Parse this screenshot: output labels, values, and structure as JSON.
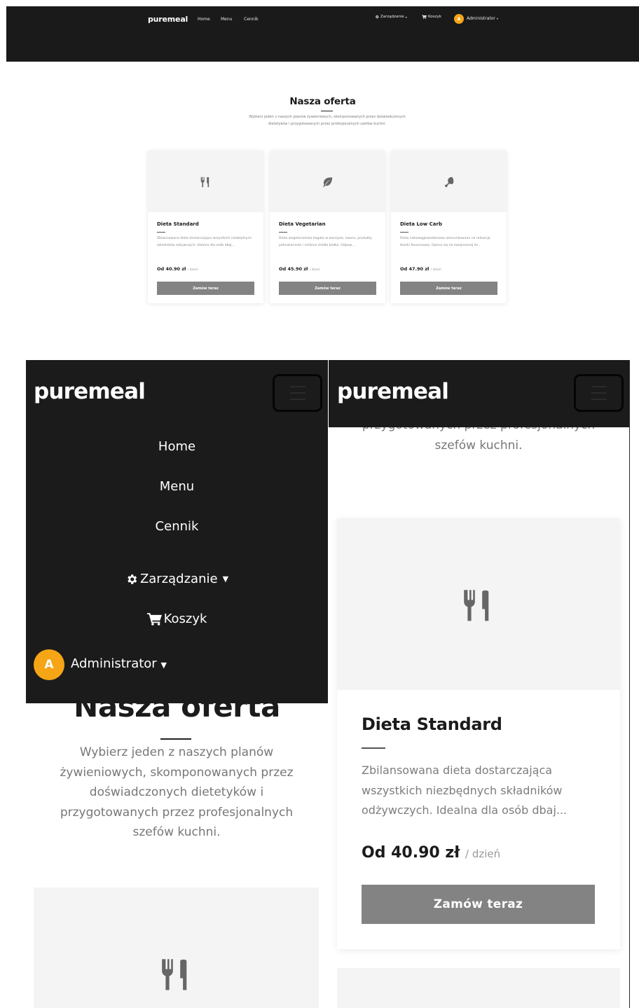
{
  "brand": "puremeal",
  "nav": {
    "links": [
      "Home",
      "Menu",
      "Cennik"
    ],
    "management": "Zarządzanie",
    "cart": "Koszyk",
    "avatar_initial": "A",
    "user": "Administrator"
  },
  "offer": {
    "title": "Nasza oferta",
    "subtitle": "Wybierz jeden z naszych planów żywieniowych, skomponowanych przez doświadczonych dietetyków i przygotowanych przez profesjonalnych szefów kuchni.",
    "subtitle_tail": "przygotowanych przez profesjonalnych szefów kuchni."
  },
  "plans": [
    {
      "name": "Dieta Standard",
      "icon": "utensils-icon",
      "description": "Zbilansowana dieta dostarczająca wszystkich niezbędnych składników odżywczych. Idealna dla osób dbaj...",
      "price": "Od 40.90 zł",
      "unit": "/ dzień",
      "button": "Zamów teraz"
    },
    {
      "name": "Dieta Vegetarian",
      "icon": "leaf-icon",
      "description": "Dieta wegetariańska bogata w warzywa, owoce, produkty pełnoziarniste i roślinne źródła białka. Odpow...",
      "price": "Od 45.90 zł",
      "unit": "/ dzień",
      "button": "Zamów teraz"
    },
    {
      "name": "Dieta Low Carb",
      "icon": "drumstick-icon",
      "description": "Dieta niskowęglowodanowa ukierunkowana na redukcję tkanki tłuszczowej. Opiera się na zwiększonej ilo...",
      "price": "Od 47.90 zł",
      "unit": "/ dzień",
      "button": "Zamów teraz"
    }
  ],
  "colors": {
    "navbar": "#1b1b1b",
    "avatar": "#f5a516",
    "button": "#838383",
    "card_image_bg": "#f4f4f4"
  }
}
